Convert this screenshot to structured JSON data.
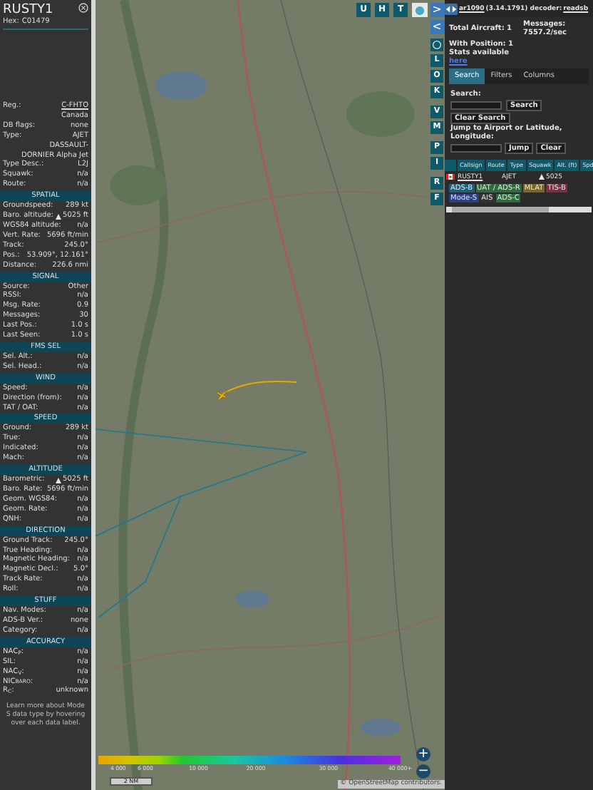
{
  "aircraft_panel": {
    "callsign": "RUSTY1",
    "hex_label": "Hex:",
    "hex": "C01479",
    "info": [
      {
        "label": "Reg.:",
        "value": "C-FHTO",
        "link": true
      },
      {
        "value": "Canada",
        "link": false
      },
      {
        "label": "DB flags:",
        "value": "none",
        "link": false
      },
      {
        "label": "Type:",
        "value": "AJET",
        "link": false
      },
      {
        "value": "DASSAULT-DORNIER Alpha Jet",
        "link": false
      },
      {
        "label": "Type Desc.:",
        "value": "L2J",
        "link": false
      },
      {
        "label": "Squawk:",
        "value": "n/a",
        "link": false
      },
      {
        "label": "Route:",
        "value": "n/a",
        "link": false
      }
    ],
    "sections": [
      {
        "title": "SPATIAL",
        "rows": [
          {
            "label": "Groundspeed:",
            "value": "289 kt",
            "marker": false
          },
          {
            "label": "Baro. altitude:",
            "value": "5025 ft",
            "marker": true
          },
          {
            "label": "WGS84 altitude:",
            "value": "n/a",
            "marker": false
          },
          {
            "label": "Vert. Rate:",
            "value": "5696 ft/min",
            "marker": false
          },
          {
            "label": "Track:",
            "value": "245.0°",
            "marker": false
          },
          {
            "label": "Pos.:",
            "value": "53.909°, 12.161°",
            "marker": false
          },
          {
            "label": "Distance:",
            "value": "226.6 nmi",
            "marker": false
          }
        ]
      },
      {
        "title": "SIGNAL",
        "rows": [
          {
            "label": "Source:",
            "value": "Other",
            "marker": false
          },
          {
            "label": "RSSI:",
            "value": "n/a",
            "marker": false
          },
          {
            "label": "Msg. Rate:",
            "value": "0.9",
            "marker": false
          },
          {
            "label": "Messages:",
            "value": "30",
            "marker": false
          },
          {
            "label": "Last Pos.:",
            "value": "1.0 s",
            "marker": false
          },
          {
            "label": "Last Seen:",
            "value": "1.0 s",
            "marker": false
          }
        ]
      },
      {
        "title": "FMS SEL",
        "rows": [
          {
            "label": "Sel. Alt.:",
            "value": "n/a",
            "marker": false
          },
          {
            "label": "Sel. Head.:",
            "value": "n/a",
            "marker": false
          }
        ]
      },
      {
        "title": "WIND",
        "rows": [
          {
            "label": "Speed:",
            "value": "n/a",
            "marker": false
          },
          {
            "label": "Direction (from):",
            "value": "n/a",
            "marker": false
          },
          {
            "label": "TAT / OAT:",
            "value": "n/a",
            "marker": false
          }
        ]
      },
      {
        "title": "SPEED",
        "rows": [
          {
            "label": "Ground:",
            "value": "289 kt",
            "marker": false
          },
          {
            "label": "True:",
            "value": "n/a",
            "marker": false
          },
          {
            "label": "Indicated:",
            "value": "n/a",
            "marker": false
          },
          {
            "label": "Mach:",
            "value": "n/a",
            "marker": false
          }
        ]
      },
      {
        "title": "ALTITUDE",
        "rows": [
          {
            "label": "Barometric:",
            "value": "5025 ft",
            "marker": true
          },
          {
            "label": "Baro. Rate:",
            "value": "5696 ft/min",
            "marker": false
          },
          {
            "label": "Geom. WGS84:",
            "value": "n/a",
            "marker": false
          },
          {
            "label": "Geom. Rate:",
            "value": "n/a",
            "marker": false
          },
          {
            "label": "QNH:",
            "value": "n/a",
            "marker": false
          }
        ]
      },
      {
        "title": "DIRECTION",
        "rows": [
          {
            "label": "Ground Track:",
            "value": "245.0°",
            "marker": false
          },
          {
            "label": "True Heading:",
            "value": "n/a",
            "marker": false
          },
          {
            "label": "Magnetic Heading:",
            "value": "n/a",
            "marker": false
          },
          {
            "label": "Magnetic Decl.:",
            "value": "5.0°",
            "marker": false
          },
          {
            "label": "Track Rate:",
            "value": "n/a",
            "marker": false
          },
          {
            "label": "Roll:",
            "value": "n/a",
            "marker": false
          }
        ]
      },
      {
        "title": "STUFF",
        "rows": [
          {
            "label": "Nav. Modes:",
            "value": "n/a",
            "marker": false
          },
          {
            "label": "ADS-B Ver.:",
            "value": "none",
            "marker": false
          },
          {
            "label": "Category:",
            "value": "n/a",
            "marker": false
          }
        ]
      },
      {
        "title": "ACCURACY",
        "rows": [
          {
            "label": "NAC$_{P}$:",
            "value": "n/a",
            "marker": false
          },
          {
            "label": "SIL:",
            "value": "n/a",
            "marker": false
          },
          {
            "label": "NAC$_{V}$:",
            "value": "n/a",
            "marker": false
          },
          {
            "label": "NIC$_{BARO}$:",
            "value": "n/a",
            "marker": false
          },
          {
            "label": "R$_{C}$:",
            "value": "unknown",
            "marker": false
          }
        ]
      }
    ],
    "footer": "Learn more about Mode S data type by hovering over each data label."
  },
  "map": {
    "top_buttons": [
      "U",
      "H",
      "T"
    ],
    "side_buttons": [
      ">",
      "<"
    ],
    "layer_buttons": [
      "L",
      "O",
      "K",
      "V",
      "M",
      "P",
      "I",
      "R",
      "F"
    ],
    "legend": [
      "4 000",
      "6 000",
      "10 000",
      "20 000",
      "30 000",
      "40 000+"
    ],
    "scale": "2 NM",
    "zoom_in": "+",
    "zoom_out": "−",
    "attribution": "© OpenStreetMap contributors."
  },
  "right_panel": {
    "app_link": "ar1090",
    "version": "(3.14.1791) decoder:",
    "decoder": "readsb",
    "stats": {
      "total": "Total Aircraft: 1",
      "messages_label": "Messages:",
      "messages": "7557.2/sec",
      "with_position": "With Position: 1",
      "stats_text": "Stats available",
      "stats_link": "here"
    },
    "tabs": [
      {
        "label": "Search",
        "selected": true
      },
      {
        "label": "Filters",
        "selected": false
      },
      {
        "label": "Columns",
        "selected": false
      }
    ],
    "search_label": "Search:",
    "search_button": "Search",
    "clear_search": "Clear Search",
    "jump_label": "Jump to Airport or Latitude, Longitude:",
    "jump_button": "Jump",
    "clear_button": "Clear",
    "table": {
      "columns": [
        "Callsign",
        "Route",
        "Type",
        "Squawk",
        "Alt. (ft)",
        "Spd"
      ],
      "rows": [
        {
          "callsign": "RUSTY1",
          "type": "AJET",
          "altitude": "5025"
        }
      ]
    },
    "sources": [
      {
        "label": "ADS-B",
        "color": "#1f5f78"
      },
      {
        "label": "UAT / ADS-R",
        "color": "#2f6b3c"
      },
      {
        "label": "MLAT",
        "color": "#7a6428"
      },
      {
        "label": "TIS-B",
        "color": "#7a2f44"
      },
      {
        "label": "Mode-S",
        "color": "#2b3f86"
      },
      {
        "label": "AIS",
        "color": "#333333"
      },
      {
        "label": "ADS-C",
        "color": "#2f6b3c"
      }
    ]
  }
}
